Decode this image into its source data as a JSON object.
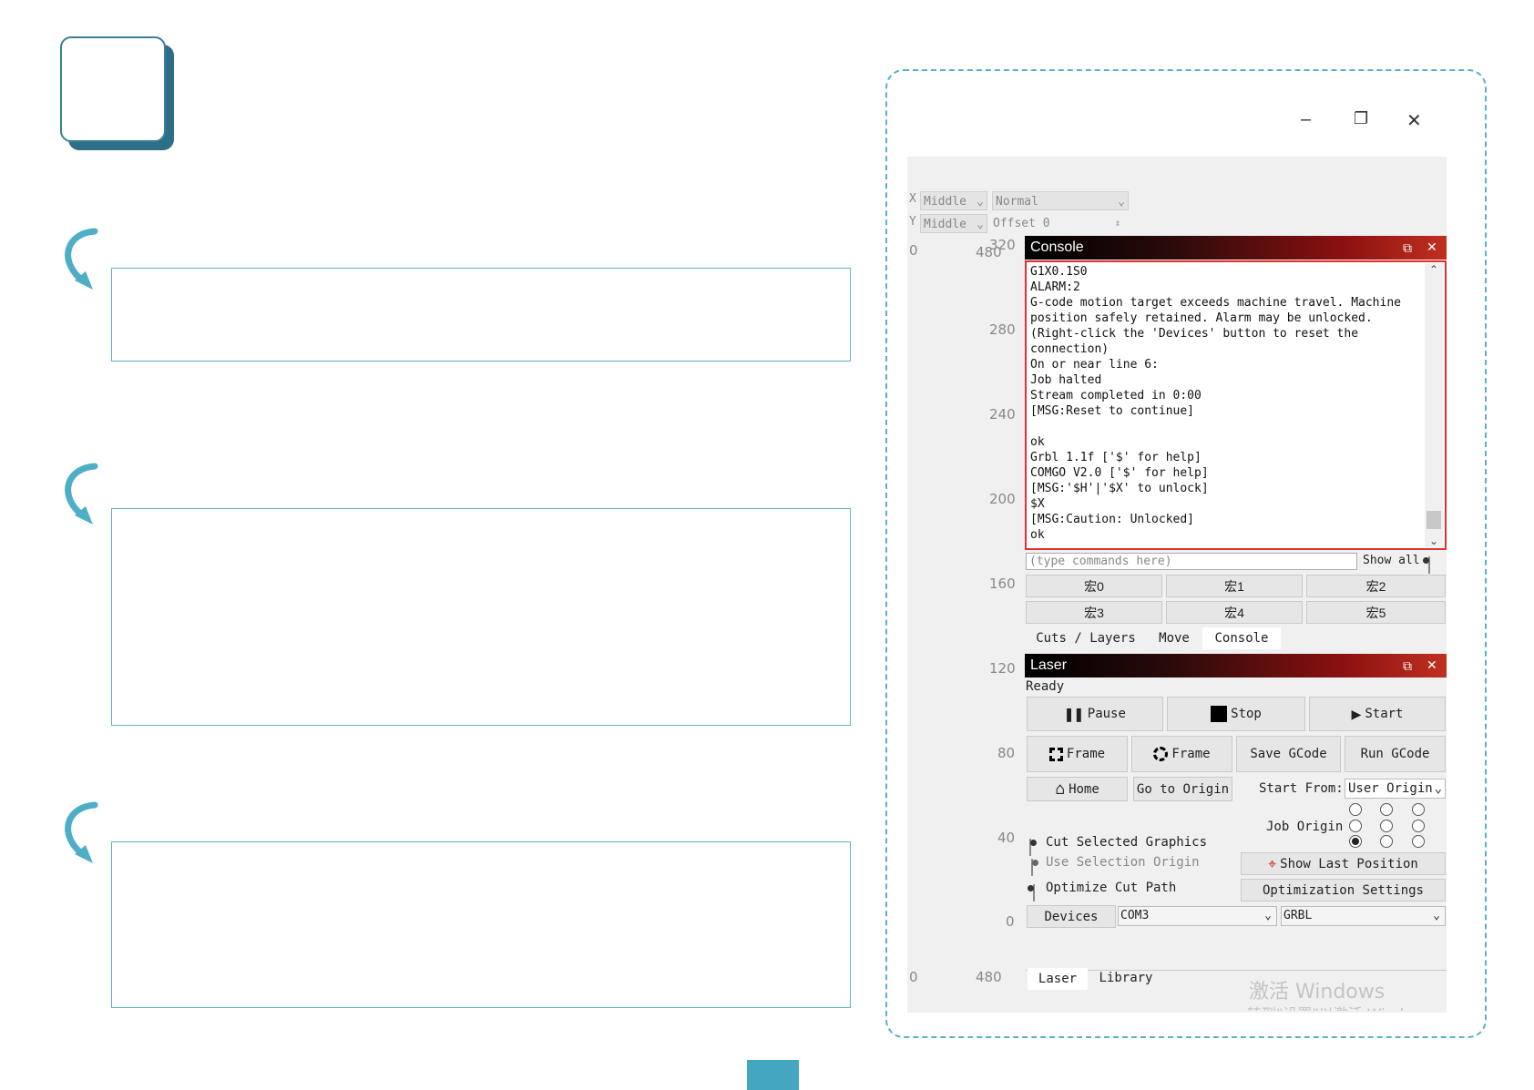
{
  "window_controls": {
    "minimize": "–",
    "maximize": "❐",
    "close": "✕"
  },
  "toolbar": {
    "x_label": "X",
    "x_align": "Middle",
    "mode": "Normal",
    "y_label": "Y",
    "y_align": "Middle",
    "offset": "Offset 0"
  },
  "ruler": {
    "top_left": "0",
    "top_480": "480",
    "top_320": "320",
    "ticks": [
      "280",
      "240",
      "200",
      "160",
      "120",
      "80",
      "40",
      "0"
    ],
    "bottom_left": "0",
    "bottom_480": "480"
  },
  "console": {
    "title": "Console",
    "lines": [
      "G1X0.1S0",
      "ALARM:2",
      "G-code motion target exceeds machine travel. Machine",
      "position safely retained. Alarm may be unlocked.",
      "(Right-click the 'Devices' button to reset the",
      "connection)",
      "On or near line 6:",
      "Job halted",
      "Stream completed in 0:00",
      "[MSG:Reset to continue]",
      "",
      "ok",
      "Grbl 1.1f ['$' for help]",
      "COMGO V2.0 ['$' for help]",
      "[MSG:'$H'|'$X' to unlock]",
      "$X",
      "[MSG:Caution: Unlocked]",
      "ok"
    ],
    "input_placeholder": "(type commands here)",
    "show_all_label": "Show all",
    "macros": [
      "宏0",
      "宏1",
      "宏2",
      "宏3",
      "宏4",
      "宏5"
    ]
  },
  "panel_tabs": [
    "Cuts / Layers",
    "Move",
    "Console"
  ],
  "laser": {
    "title": "Laser",
    "status": "Ready",
    "pause": "Pause",
    "stop": "Stop",
    "start": "Start",
    "frame1": "Frame",
    "frame2": "Frame",
    "save_gcode": "Save GCode",
    "run_gcode": "Run GCode",
    "home": "Home",
    "go_to_origin": "Go to Origin",
    "start_from_label": "Start From:",
    "start_from_value": "User Origin",
    "job_origin_label": "Job Origin",
    "cut_selected": "Cut Selected Graphics",
    "use_selection_origin": "Use Selection Origin",
    "optimize_cut_path": "Optimize Cut Path",
    "show_last_position": "Show Last Position",
    "optimization_settings": "Optimization Settings",
    "devices": "Devices",
    "port": "COM3",
    "controller": "GRBL"
  },
  "bottom_tabs": [
    "Laser",
    "Library"
  ],
  "watermark": {
    "line1": "激活 Windows",
    "line2": "转到\"设置\"以激活 Windows。"
  },
  "colors": {
    "accent_teal": "#44a6c0",
    "console_border": "#e03030"
  }
}
